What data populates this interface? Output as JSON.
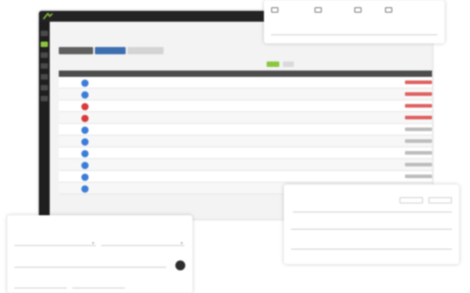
{
  "colors": {
    "accent_green": "#8cc63f",
    "status_red": "#d93a3a",
    "status_blue": "#3b7dd8",
    "topbar": "#232323"
  },
  "app": {
    "topbar": {
      "nav_items": [
        "",
        ""
      ]
    },
    "breadcrumb": "",
    "toolbar": {
      "buttons": [
        "",
        "",
        ""
      ]
    },
    "grid": {
      "columns": [
        "",
        "",
        "",
        "",
        "",
        "",
        "",
        ""
      ],
      "rows": [
        {
          "status": "blue",
          "name": "",
          "c1": "",
          "c2": "",
          "c3": "",
          "c4": "",
          "c5": "",
          "badge": "red"
        },
        {
          "status": "blue",
          "name": "",
          "c1": "",
          "c2": "",
          "c3": "",
          "c4": "",
          "c5": "",
          "badge": "red"
        },
        {
          "status": "red",
          "name": "",
          "c1": "",
          "c2": "",
          "c3": "",
          "c4": "",
          "c5": "",
          "badge": "red"
        },
        {
          "status": "red",
          "name": "",
          "c1": "",
          "c2": "",
          "c3": "",
          "c4": "",
          "c5": "",
          "badge": "red"
        },
        {
          "status": "blue",
          "name": "",
          "c1": "",
          "c2": "",
          "c3": "",
          "c4": "",
          "c5": "",
          "badge": "grey"
        },
        {
          "status": "blue",
          "name": "",
          "c1": "",
          "c2": "",
          "c3": "",
          "c4": "",
          "c5": "",
          "badge": "grey"
        },
        {
          "status": "blue",
          "name": "",
          "c1": "",
          "c2": "",
          "c3": "",
          "c4": "",
          "c5": "",
          "badge": "grey"
        },
        {
          "status": "blue",
          "name": "",
          "c1": "",
          "c2": "",
          "c3": "",
          "c4": "",
          "c5": "",
          "badge": "grey"
        },
        {
          "status": "blue",
          "name": "",
          "c1": "",
          "c2": "",
          "c3": "",
          "c4": "",
          "c5": "",
          "badge": "grey"
        },
        {
          "status": "blue",
          "name": "",
          "c1": "",
          "c2": "",
          "c3": "",
          "c4": "",
          "c5": "",
          "badge": "grey"
        }
      ]
    }
  },
  "top_card": {
    "title": "",
    "icons": [
      "monitor-icon",
      "grid-icon",
      "chart-icon",
      "user-icon"
    ]
  },
  "right_card": {
    "title": "",
    "labels": [
      "",
      "",
      ""
    ],
    "buttons": [
      "",
      ""
    ]
  },
  "left_card": {
    "title": "",
    "labels": [
      "",
      "",
      "",
      "",
      ""
    ]
  }
}
